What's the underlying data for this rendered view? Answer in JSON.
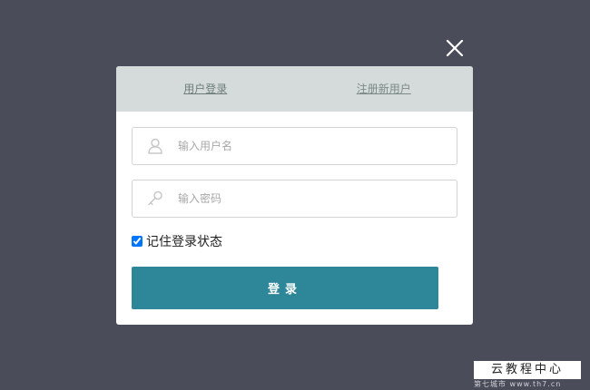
{
  "tabs": {
    "login": "用户登录",
    "register": "注册新用户"
  },
  "form": {
    "username_placeholder": "输入用户名",
    "password_placeholder": "输入密码",
    "remember_label": "记住登录状态",
    "remember_checked": true,
    "submit_label": "登录"
  },
  "icons": {
    "close": "close-icon",
    "user": "user-icon",
    "key": "key-icon"
  },
  "colors": {
    "overlay": "#4a4c59",
    "tab_bar": "#d5dbda",
    "button": "#2e8799"
  },
  "watermark": {
    "title": "云教程中心",
    "subtitle": "第七城市  www.th7.cn"
  }
}
